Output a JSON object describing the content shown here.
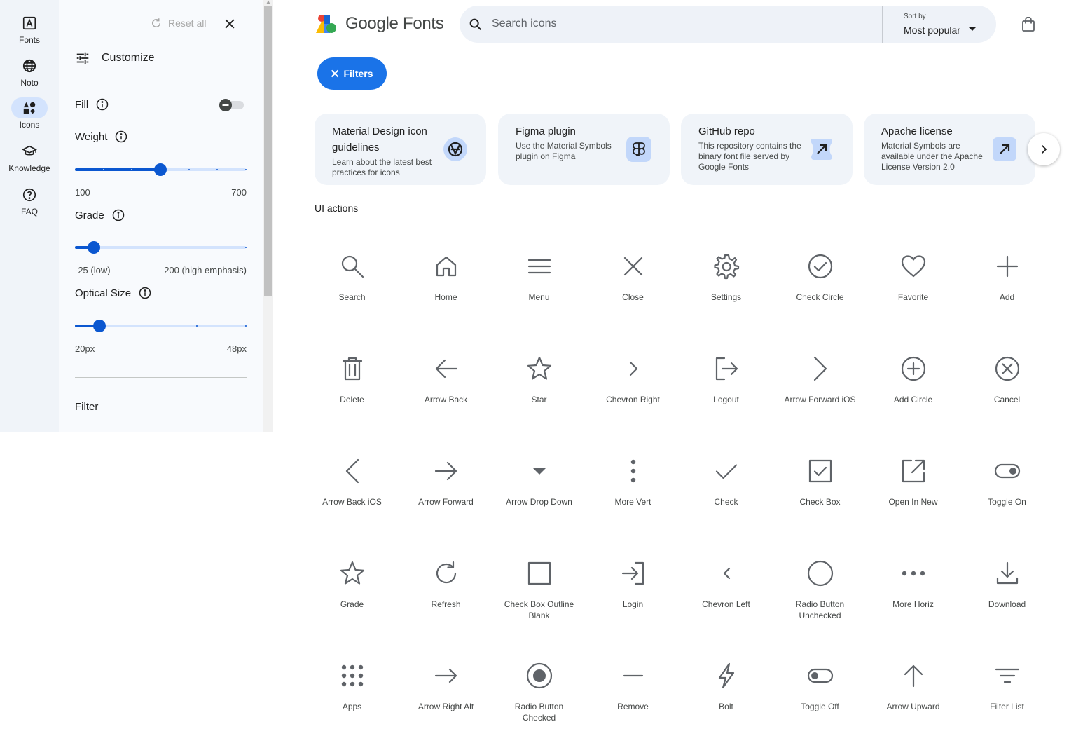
{
  "rail": [
    {
      "label": "Fonts",
      "icon": "fonts-icon"
    },
    {
      "label": "Noto",
      "icon": "globe-icon"
    },
    {
      "label": "Icons",
      "icon": "icons-icon",
      "active": true
    },
    {
      "label": "Knowledge",
      "icon": "school-icon"
    },
    {
      "label": "FAQ",
      "icon": "help-icon"
    }
  ],
  "panel": {
    "reset_label": "Reset all",
    "customize_label": "Customize",
    "fill_label": "Fill",
    "fill_on": false,
    "weight": {
      "label": "Weight",
      "min_label": "100",
      "max_label": "700",
      "value": 400
    },
    "grade": {
      "label": "Grade",
      "min_label": "-25 (low)",
      "max_label": "200 (high emphasis)",
      "value": 0
    },
    "optical": {
      "label": "Optical Size",
      "min_label": "20px",
      "max_label": "48px",
      "value": 24
    },
    "filter_label": "Filter"
  },
  "header": {
    "logo_text": "Google Fonts",
    "search_placeholder": "Search icons",
    "sort_label": "Sort by",
    "sort_value": "Most popular"
  },
  "filters_label": "Filters",
  "cards": [
    {
      "title": "Material Design icon guidelines",
      "desc": "Learn about the latest best practices for icons",
      "icon": "material-logo-icon"
    },
    {
      "title": "Figma plugin",
      "desc": "Use the Material Symbols plugin on Figma",
      "icon": "figma-icon"
    },
    {
      "title": "GitHub repo",
      "desc": "This repository contains the binary font file served by Google Fonts",
      "icon": "arrow-outward-icon"
    },
    {
      "title": "Apache license",
      "desc": "Material Symbols are available under the Apache License Version 2.0",
      "icon": "arrow-outward-icon"
    }
  ],
  "section_title": "UI actions",
  "icons": [
    [
      "Search",
      "Home",
      "Menu",
      "Close",
      "Settings",
      "Check Circle",
      "Favorite",
      "Add"
    ],
    [
      "Delete",
      "Arrow Back",
      "Star",
      "Chevron Right",
      "Logout",
      "Arrow Forward iOS",
      "Add Circle",
      "Cancel"
    ],
    [
      "Arrow Back iOS",
      "Arrow Forward",
      "Arrow Drop Down",
      "More Vert",
      "Check",
      "Check Box",
      "Open In New",
      "Toggle On"
    ],
    [
      "Grade",
      "Refresh",
      "Check Box Outline Blank",
      "Login",
      "Chevron Left",
      "Radio Button Unchecked",
      "More Horiz",
      "Download"
    ],
    [
      "Apps",
      "Arrow Right Alt",
      "Radio Button Checked",
      "Remove",
      "Bolt",
      "Toggle Off",
      "Arrow Upward",
      "Filter List"
    ]
  ],
  "colors": {
    "accent": "#0b57d0",
    "filters_button": "#1a73e8",
    "icon": "#5f6368"
  }
}
